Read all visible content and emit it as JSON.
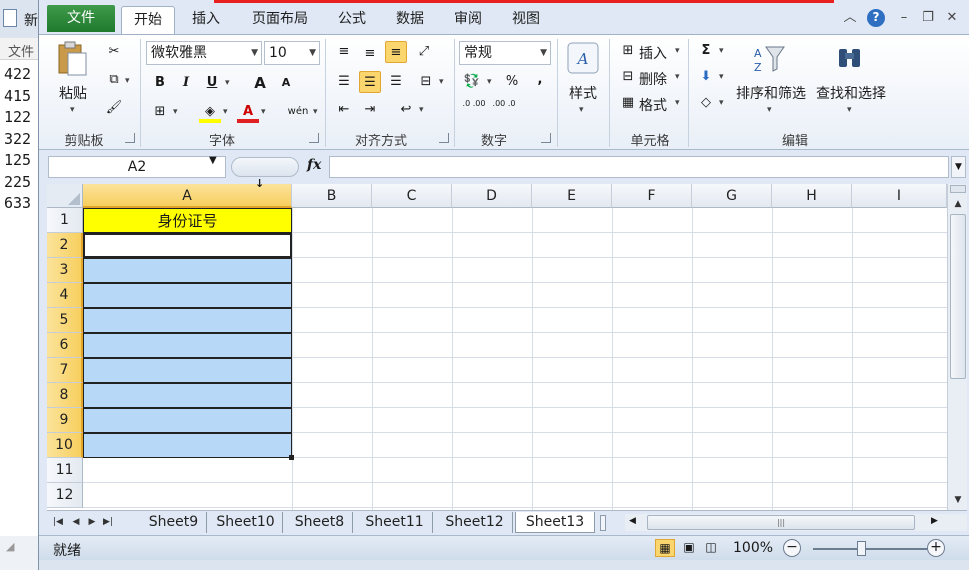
{
  "background_window": {
    "title": "新",
    "menu": "文件",
    "lines": [
      "422",
      "415",
      "122",
      "322",
      "125",
      "225",
      "633"
    ]
  },
  "ribbon_tabs": [
    "文件",
    "开始",
    "插入",
    "页面布局",
    "公式",
    "数据",
    "审阅",
    "视图"
  ],
  "clipboard": {
    "paste": "粘贴",
    "label": "剪贴板"
  },
  "font": {
    "name": "微软雅黑",
    "size": "10",
    "label": "字体",
    "bold": "B",
    "italic": "I",
    "underline": "U",
    "grow": "A",
    "shrink": "A",
    "font_color": "A",
    "phonetic": "wén"
  },
  "alignment": {
    "label": "对齐方式"
  },
  "number": {
    "format": "常规",
    "label": "数字",
    "percent": "%",
    "comma": ",",
    "inc_decimal": ".0 .00",
    "dec_decimal": ".00 .0"
  },
  "styles": {
    "label": "样式"
  },
  "cells": {
    "insert": "插入",
    "delete": "删除",
    "format": "格式",
    "label": "单元格"
  },
  "editing": {
    "sum": "Σ",
    "sort_filter": "排序和筛选",
    "find_select": "查找和选择",
    "label": "编辑"
  },
  "formula_bar": {
    "name_box": "A2",
    "fx": "fx"
  },
  "columns": [
    "A",
    "B",
    "C",
    "D",
    "E",
    "F",
    "G",
    "H",
    "I"
  ],
  "rows": [
    "1",
    "2",
    "3",
    "4",
    "5",
    "6",
    "7",
    "8",
    "9",
    "10",
    "11",
    "12"
  ],
  "cell_A1": "身份证号",
  "sheets": [
    "Sheet9",
    "Sheet10",
    "Sheet8",
    "Sheet11",
    "Sheet12",
    "Sheet13"
  ],
  "active_sheet": "Sheet13",
  "status": {
    "text": "就绪",
    "zoom": "100%"
  },
  "colors": {
    "header_fill": "#ffff00",
    "selection_fill": "#b8d8f7",
    "file_tab": "#2a8a3a"
  }
}
